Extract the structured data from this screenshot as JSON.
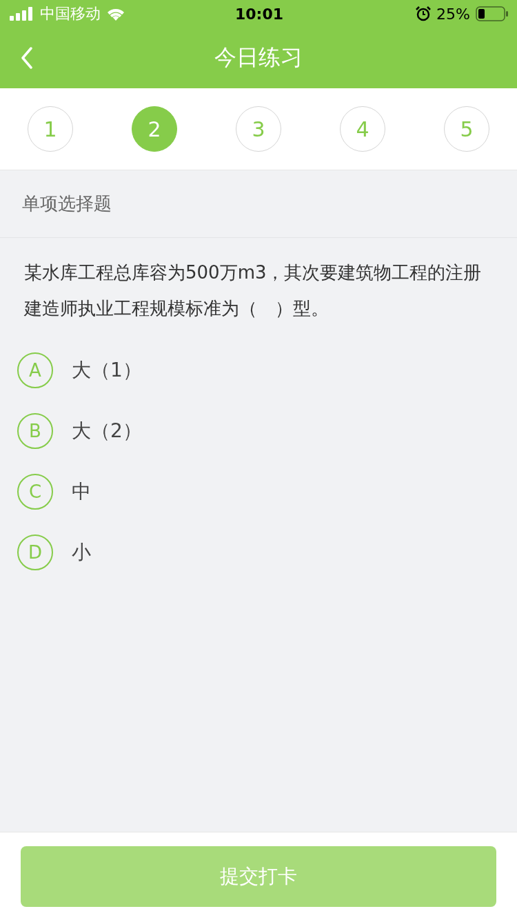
{
  "status_bar": {
    "carrier": "中国移动",
    "time": "10:01",
    "battery": "25%"
  },
  "nav": {
    "title": "今日练习"
  },
  "steps": [
    {
      "label": "1",
      "selected": false
    },
    {
      "label": "2",
      "selected": true
    },
    {
      "label": "3",
      "selected": false
    },
    {
      "label": "4",
      "selected": false
    },
    {
      "label": "5",
      "selected": false
    }
  ],
  "section": {
    "title": "单项选择题"
  },
  "question": {
    "text": "某水库工程总库容为500万m3，其次要建筑物工程的注册建造师执业工程规模标准为（　）型。"
  },
  "options": [
    {
      "letter": "A",
      "text": "大（1）",
      "selected": false
    },
    {
      "letter": "B",
      "text": "大（2）",
      "selected": false
    },
    {
      "letter": "C",
      "text": "中",
      "selected": false
    },
    {
      "letter": "D",
      "text": "小",
      "selected": false
    }
  ],
  "submit": {
    "label": "提交打卡",
    "disabled": true
  }
}
